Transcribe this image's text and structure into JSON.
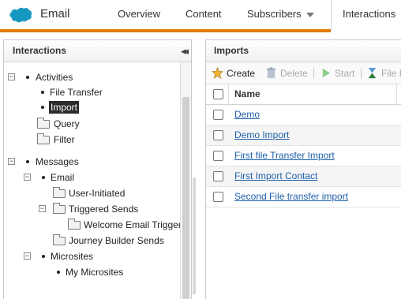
{
  "app": {
    "name": "Email",
    "brand_color": "#1798c1",
    "accent_color": "#e07c00"
  },
  "nav": {
    "tabs": [
      {
        "label": "Overview"
      },
      {
        "label": "Content"
      },
      {
        "label": "Subscribers",
        "has_dropdown": true
      },
      {
        "label": "Interactions",
        "active": true
      }
    ]
  },
  "left": {
    "title": "Interactions",
    "collapse_icon": "double-chevron-left-icon",
    "tree": [
      {
        "label": "Activities",
        "toggle": "−",
        "type": "bullet"
      },
      {
        "label": "File Transfer",
        "type": "bullet"
      },
      {
        "label": "Import",
        "type": "bullet",
        "selected": true
      },
      {
        "label": "Query",
        "type": "folder"
      },
      {
        "label": "Filter",
        "type": "folder"
      },
      {
        "label": "Messages",
        "toggle": "−",
        "type": "bullet"
      },
      {
        "label": "Email",
        "toggle": "−",
        "type": "bullet"
      },
      {
        "label": "User-Initiated",
        "type": "folder"
      },
      {
        "label": "Triggered Sends",
        "toggle": "−",
        "type": "folder"
      },
      {
        "label": "Welcome Email Trigger",
        "type": "folder"
      },
      {
        "label": "Journey Builder Sends",
        "type": "folder"
      },
      {
        "label": "Microsites",
        "toggle": "−",
        "type": "bullet"
      },
      {
        "label": "My Microsites",
        "type": "bullet"
      }
    ]
  },
  "right": {
    "title": "Imports",
    "toolbar": {
      "create": "Create",
      "delete": "Delete",
      "start": "Start",
      "file": "File I"
    },
    "grid": {
      "column_name": "Name",
      "rows": [
        "Demo",
        "Demo Import",
        "First file Transfer Import",
        "First Import Contact",
        "Second File transfer import"
      ]
    }
  }
}
